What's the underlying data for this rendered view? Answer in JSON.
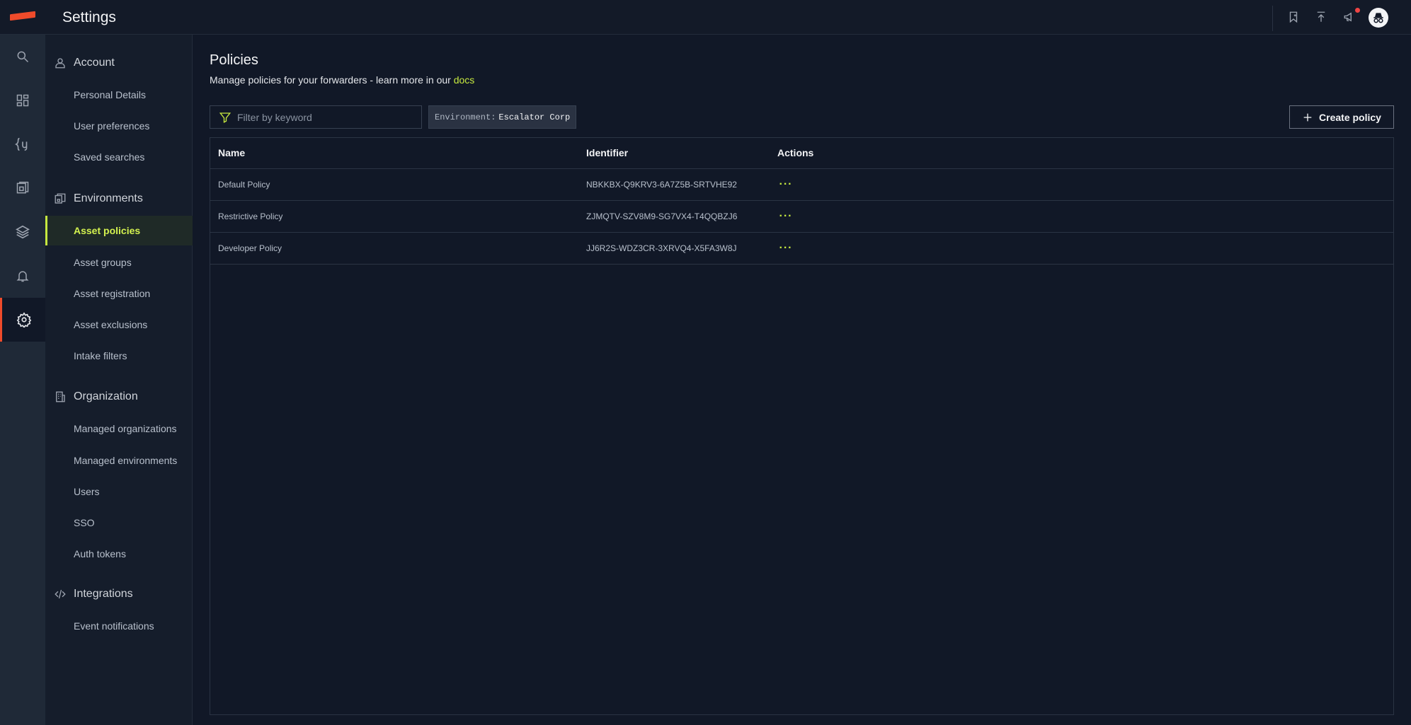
{
  "app": {
    "title": "Settings"
  },
  "colors": {
    "accent": "#c6e83f",
    "brand": "#ef4b2b",
    "notification": "#ef4444"
  },
  "topbar": {
    "icons": [
      "bookmark-icon",
      "upload-icon",
      "megaphone-icon",
      "incognito-avatar"
    ]
  },
  "rail": {
    "items": [
      "search-icon",
      "dashboard-icon",
      "query-icon",
      "reports-icon",
      "layers-icon",
      "bell-icon",
      "gear-icon"
    ],
    "active": "gear-icon"
  },
  "nav": {
    "sections": [
      {
        "label": "Account",
        "icon": "user-icon",
        "items": [
          "Personal Details",
          "User preferences",
          "Saved searches"
        ]
      },
      {
        "label": "Environments",
        "icon": "environments-icon",
        "items": [
          "Asset policies",
          "Asset groups",
          "Asset registration",
          "Asset exclusions",
          "Intake filters"
        ]
      },
      {
        "label": "Organization",
        "icon": "building-icon",
        "items": [
          "Managed organizations",
          "Managed environments",
          "Users",
          "SSO",
          "Auth tokens"
        ]
      },
      {
        "label": "Integrations",
        "icon": "code-icon",
        "items": [
          "Event notifications"
        ]
      }
    ],
    "active_item": "Asset policies"
  },
  "main": {
    "title": "Policies",
    "description": "Manage policies for your forwarders - learn more in our ",
    "docs_link": "docs",
    "filter_placeholder": "Filter by keyword",
    "environment_key": "Environment:",
    "environment_value": "Escalator Corp",
    "create_button": "Create policy",
    "table": {
      "columns": [
        "Name",
        "Identifier",
        "Actions"
      ],
      "rows": [
        {
          "name": "Default Policy",
          "identifier": "NBKKBX-Q9KRV3-6A7Z5B-SRTVHE92",
          "actions": "···"
        },
        {
          "name": "Restrictive Policy",
          "identifier": "ZJMQTV-SZV8M9-SG7VX4-T4QQBZJ6",
          "actions": "···"
        },
        {
          "name": "Developer Policy",
          "identifier": "JJ6R2S-WDZ3CR-3XRVQ4-X5FA3W8J",
          "actions": "···"
        }
      ]
    }
  }
}
